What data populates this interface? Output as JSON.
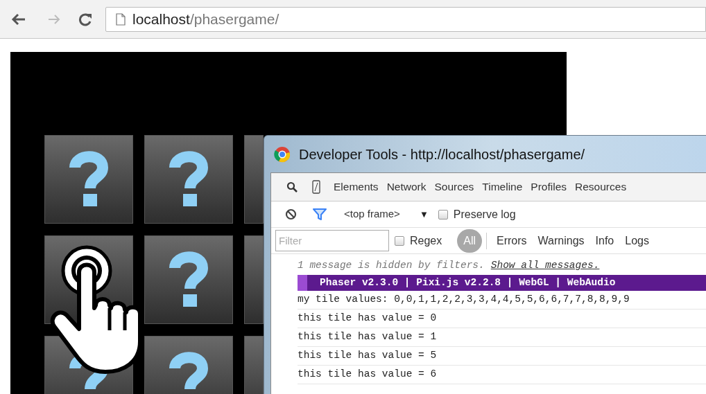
{
  "browser": {
    "url_host": "localhost",
    "url_path": "/phasergame/"
  },
  "devtools": {
    "title": "Developer Tools - http://localhost/phasergame/",
    "tabs": [
      {
        "label": "Elements",
        "selected": false
      },
      {
        "label": "Network",
        "selected": false
      },
      {
        "label": "Sources",
        "selected": false
      },
      {
        "label": "Timeline",
        "selected": false
      },
      {
        "label": "Profiles",
        "selected": false
      },
      {
        "label": "Resources",
        "selected": false
      }
    ],
    "frame_select": "<top frame>",
    "dropdown_arrow": "▼",
    "preserve_log": {
      "label": "Preserve log",
      "checked": false
    },
    "filter": {
      "placeholder": "Filter"
    },
    "regex": {
      "label": "Regex",
      "checked": false
    },
    "levels": [
      {
        "label": "All",
        "selected": true
      },
      {
        "label": "Errors",
        "selected": false
      },
      {
        "label": "Warnings",
        "selected": false
      },
      {
        "label": "Info",
        "selected": false
      },
      {
        "label": "Logs",
        "selected": false
      }
    ],
    "hidden_notice": {
      "text": "1 message is hidden by filters.",
      "link": "Show all messages."
    },
    "banner": "Phaser v2.3.0 | Pixi.js v2.2.8 | WebGL | WebAudio",
    "messages": [
      "my tile values: 0,0,1,1,2,2,3,3,4,4,5,5,6,6,7,7,8,8,9,9",
      "this tile has value = 0",
      "this tile has value = 1",
      "this tile has value = 5",
      "this tile has value = 6"
    ]
  }
}
